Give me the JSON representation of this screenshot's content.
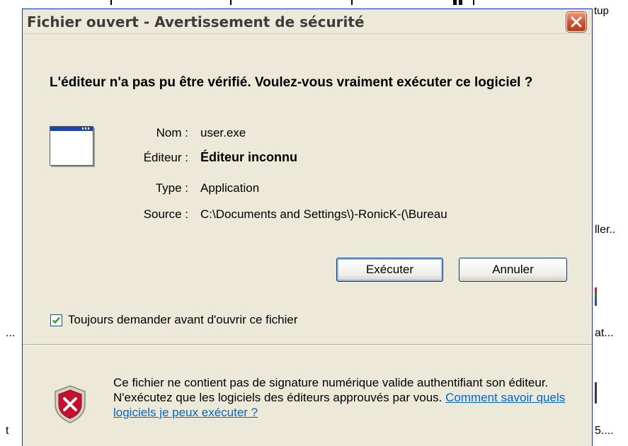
{
  "background": {
    "fragments": [
      {
        "id": "tup",
        "text": "tup"
      },
      {
        "id": "ller",
        "text": "ller.."
      },
      {
        "id": "ellipsis-left",
        "text": "..."
      },
      {
        "id": "at",
        "text": "at..."
      },
      {
        "id": "t",
        "text": "t"
      },
      {
        "id": "five",
        "text": "5...."
      }
    ]
  },
  "dialog": {
    "title": "Fichier ouvert - Avertissement de sécurité",
    "heading": "L'éditeur n'a pas pu être vérifié. Voulez-vous vraiment exécuter ce logiciel ?",
    "icon": "application-window-icon",
    "fields": {
      "name": {
        "label": "Nom :",
        "value": "user.exe"
      },
      "publisher": {
        "label": "Éditeur :",
        "value": "Éditeur inconnu"
      },
      "type": {
        "label": "Type :",
        "value": "Application"
      },
      "source": {
        "label": "Source :",
        "value": "C:\\Documents and Settings\\)-RonicK-(\\Bureau"
      }
    },
    "buttons": {
      "run": "Exécuter",
      "cancel": "Annuler"
    },
    "checkbox": {
      "label": "Toujours demander avant d'ouvrir ce fichier",
      "checked": true
    },
    "warning": {
      "icon": "security-shield-icon",
      "text": "Ce fichier ne contient pas de signature numérique valide authentifiant son éditeur. N'exécutez que les logiciels des éditeurs approuvés par vous. ",
      "link": "Comment savoir quels logiciels je peux exécuter ?"
    }
  },
  "colors": {
    "dialog_bg": "#ece9d8",
    "close_button": "#d0502a",
    "link": "#0066cc",
    "shield": "#c8102e"
  }
}
